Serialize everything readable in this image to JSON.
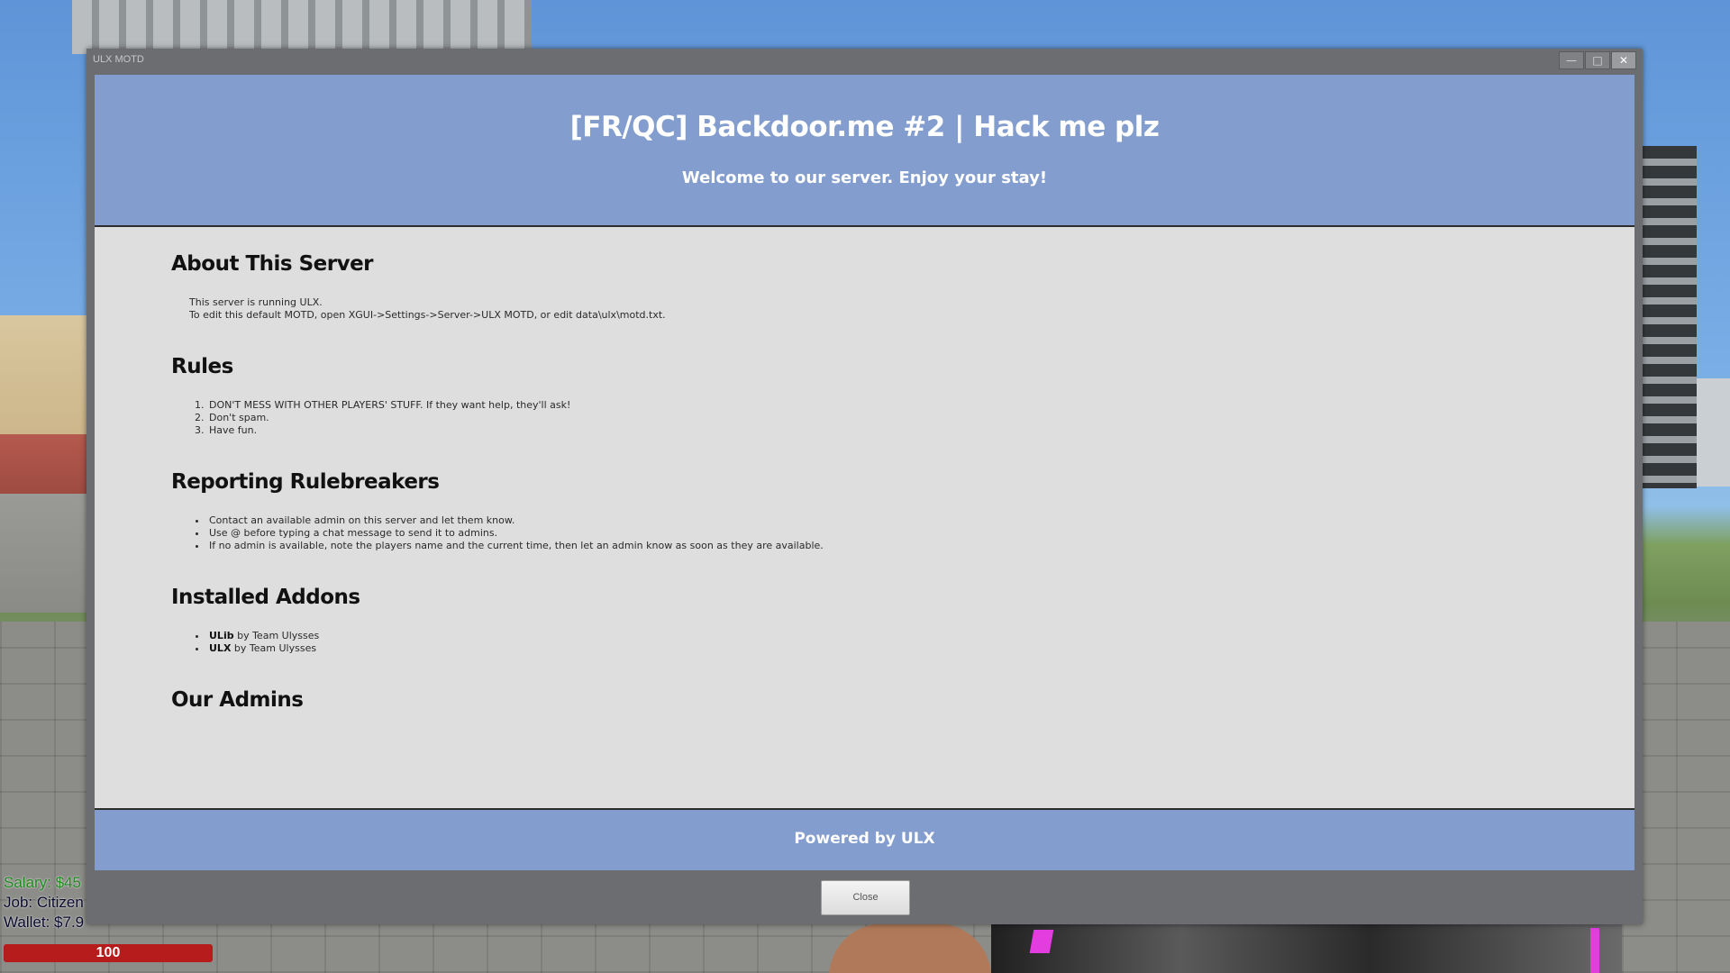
{
  "window": {
    "title": "ULX MOTD",
    "controls": {
      "minimize": "—",
      "maximize": "□",
      "close": "✕"
    }
  },
  "header": {
    "title": "[FR/QC] Backdoor.me #2 | Hack me plz",
    "subtitle": "Welcome to our server. Enjoy your stay!"
  },
  "sections": {
    "about": {
      "heading": "About This Server",
      "lines": [
        "This server is running ULX.",
        "To edit this default MOTD, open XGUI->Settings->Server->ULX MOTD, or edit data\\ulx\\motd.txt."
      ]
    },
    "rules": {
      "heading": "Rules",
      "items": [
        "DON'T MESS WITH OTHER PLAYERS' STUFF. If they want help, they'll ask!",
        "Don't spam.",
        "Have fun."
      ]
    },
    "reporting": {
      "heading": "Reporting Rulebreakers",
      "items": [
        "Contact an available admin on this server and let them know.",
        "Use @ before typing a chat message to send it to admins.",
        "If no admin is available, note the players name and the current time, then let an admin know as soon as they are available."
      ]
    },
    "addons": {
      "heading": "Installed Addons",
      "items": [
        {
          "name": "ULib",
          "author": " by Team Ulysses"
        },
        {
          "name": "ULX",
          "author": " by Team Ulysses"
        }
      ]
    },
    "admins": {
      "heading": "Our Admins"
    }
  },
  "footer": {
    "text": "Powered by ULX"
  },
  "close_button": {
    "label": "Close"
  },
  "hud": {
    "salary": "Salary: $45",
    "job": "Job: Citizen",
    "wallet": "Wallet: $7.9",
    "health": "100"
  },
  "colors": {
    "header_bg": "#839ece",
    "body_bg": "#dedede",
    "window_frame": "#6b6d70",
    "health_bar": "#b61c1c"
  }
}
